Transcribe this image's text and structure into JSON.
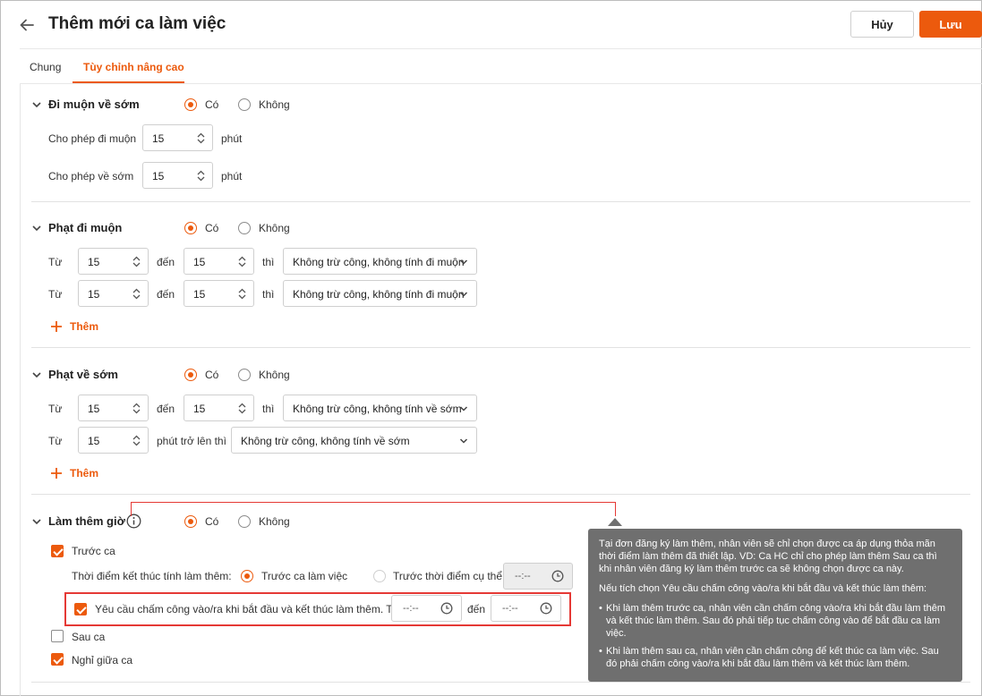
{
  "header": {
    "title": "Thêm mới ca làm việc",
    "cancel_label": "Hủy",
    "save_label": "Lưu"
  },
  "tabs": [
    {
      "label": "Chung",
      "active": false
    },
    {
      "label": "Tùy chỉnh nâng cao",
      "active": true
    }
  ],
  "common": {
    "yes": "Có",
    "no": "Không",
    "unit_minutes": "phút",
    "from": "Từ",
    "to": "đến",
    "then": "thì",
    "add": "Thêm"
  },
  "late_early": {
    "title": "Đi muộn về sớm",
    "selected": "Có",
    "allow_late_label": "Cho phép đi muộn",
    "allow_late_value": "15",
    "allow_early_label": "Cho phép về sớm",
    "allow_early_value": "15"
  },
  "late_penalty": {
    "title": "Phạt đi muộn",
    "selected": "Có",
    "rows": [
      {
        "from": "15",
        "to": "15",
        "action": "Không trừ công, không tính đi muộn"
      },
      {
        "from": "15",
        "to": "15",
        "action": "Không trừ công, không tính đi muộn"
      }
    ]
  },
  "early_penalty": {
    "title": "Phạt về sớm",
    "selected": "Có",
    "rows": [
      {
        "from": "15",
        "to": "15",
        "action": "Không trừ công, không tính về sớm"
      },
      {
        "from": "15",
        "over_label": "phút trở lên thì",
        "action": "Không trừ công, không tính về sớm"
      }
    ]
  },
  "overtime": {
    "title": "Làm thêm giờ",
    "selected": "Có",
    "before_shift_label": "Trước ca",
    "before_shift_checked": true,
    "end_time_label": "Thời điểm kết thúc tính làm thêm:",
    "option_before_shift": "Trước ca làm việc",
    "option_before_specific": "Trước thời điểm cụ thể",
    "selected_option": "Trước ca làm việc",
    "specific_time_placeholder": "--:--",
    "require_checkin_label": "Yêu cầu chấm công vào/ra khi bắt đầu và kết thúc làm thêm. Từ",
    "require_checkin_checked": true,
    "from_time_placeholder": "--:--",
    "to_time_placeholder": "--:--",
    "after_shift_label": "Sau ca",
    "after_shift_checked": false,
    "break_label": "Nghỉ giữa ca",
    "break_checked": true
  },
  "tooltip": {
    "para1": "Tại đơn đăng ký làm thêm, nhân viên sẽ chỉ chọn được ca áp dụng thỏa mãn thời điểm làm thêm đã thiết lập. VD: Ca HC chỉ cho phép làm thêm Sau ca thì khi nhân viên đăng ký làm thêm trước ca sẽ không chọn được ca này.",
    "para2": "Nếu tích chọn Yêu cầu chấm công vào/ra khi bắt đầu và kết thúc làm thêm:",
    "bullet1": "Khi làm thêm trước ca, nhân viên cần chấm công vào/ra khi bắt đầu làm thêm và kết thúc làm thêm. Sau đó phải tiếp tục chấm công vào để bắt đầu ca làm việc.",
    "bullet2": "Khi làm thêm sau ca, nhân viên cần chấm công để kết thúc ca làm việc. Sau đó phải chấm công vào/ra khi bắt đầu làm thêm và kết thúc làm thêm."
  },
  "colors": {
    "accent": "#ec5a0d",
    "highlight": "#e53935",
    "tooltip_bg": "#6f6f6f"
  }
}
